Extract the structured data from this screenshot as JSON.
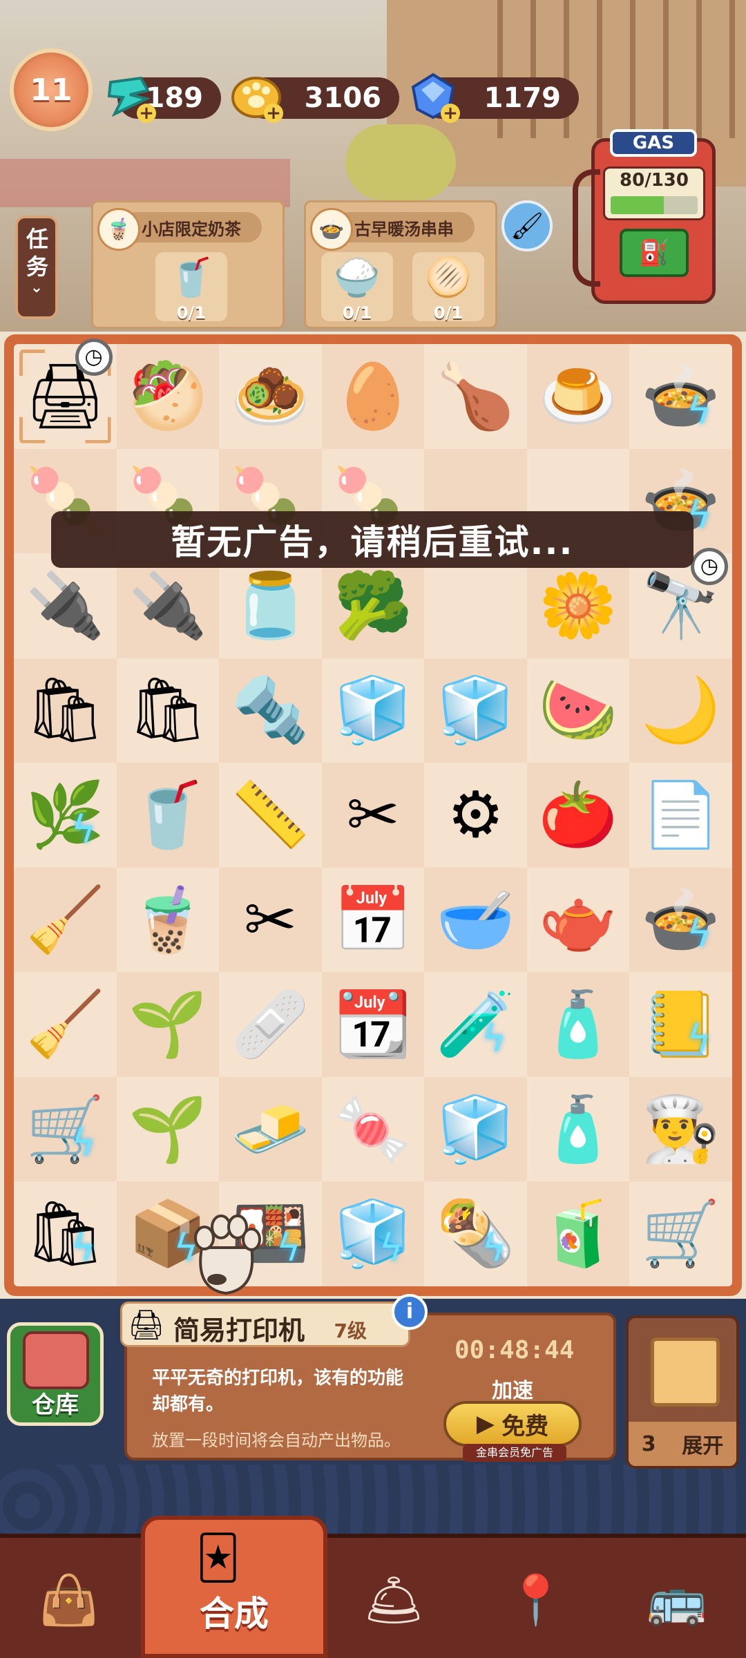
{
  "hud": {
    "level": "11",
    "energy": "189",
    "coins": "3106",
    "gems": "1179"
  },
  "quest": {
    "tab_label": "任务",
    "orders": [
      {
        "title": "小店限定奶茶",
        "icon": "milk-tea-icon",
        "items": [
          {
            "icon": "milk-tea-cup-icon",
            "progress": "0/1"
          }
        ]
      },
      {
        "title": "古早暖汤串串",
        "icon": "skewer-soup-icon",
        "items": [
          {
            "icon": "rice-bag-icon",
            "progress": "0/1"
          },
          {
            "icon": "flatbread-icon",
            "progress": "0/1"
          }
        ]
      }
    ]
  },
  "gas": {
    "label": "GAS",
    "value": "80/130",
    "fill_fraction": 0.615
  },
  "toast": "暂无广告，请稍后重试...",
  "board": {
    "cells": [
      [
        "printer",
        "toast-herbs",
        "meatball",
        "egg",
        "roast-chicken",
        "pudding-cups",
        "hotpot-bolt"
      ],
      [
        "skewer-cards",
        "skewer-cards",
        "skewer-cards",
        "skewer-cards",
        "",
        "",
        "hotpot-bolt"
      ],
      [
        "power-box",
        "power-box",
        "chili-jar",
        "broccoli",
        "",
        "flower",
        "telescope"
      ],
      [
        "paper-bag",
        "paper-bag",
        "screw",
        "sugar-cube",
        "sugar-cubes",
        "watermelon",
        "moon"
      ],
      [
        "plant-bolt",
        "purple-drink",
        "tape-measure",
        "cutter",
        "gears",
        "ketchup",
        "paper-scraps"
      ],
      [
        "dustpan",
        "bubble-tea",
        "scissors",
        "calendar",
        "bowl",
        "teapot",
        "hotpot-bolt"
      ],
      [
        "dustpan",
        "seedling",
        "tape",
        "calendars",
        "ink-bolt",
        "bottle",
        "notepad-bolt"
      ],
      [
        "cart-bolt",
        "sprout",
        "butter",
        "gum",
        "sugar-pile",
        "bottles",
        "chef-hat"
      ],
      [
        "bag-bolt",
        "crate-bolt",
        "tray-bolt",
        "fridge-bolt",
        "rolls-bolt",
        "cooler",
        "hand-truck"
      ]
    ]
  },
  "item_info": {
    "name": "简易打印机",
    "level": "7级",
    "description": "平平无奇的打印机，该有的功能却都有。",
    "hint": "放置一段时间将会自动产出物品。",
    "timer": "00:48:44",
    "speed_label": "加速",
    "free_label": "免费",
    "vip_note": "金串会员免广告"
  },
  "warehouse_label": "仓库",
  "expand": {
    "count": "3",
    "label": "展开"
  },
  "nav": {
    "active_label": "合成"
  }
}
